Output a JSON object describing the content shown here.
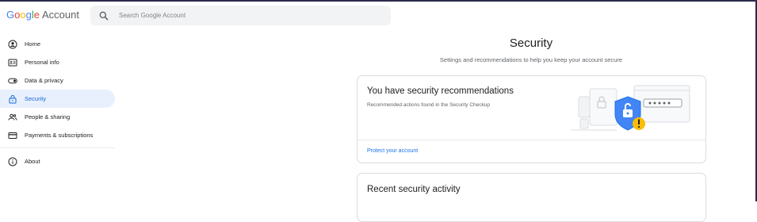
{
  "header": {
    "logo_google": [
      "G",
      "o",
      "o",
      "g",
      "l",
      "e"
    ],
    "logo_account": "Account",
    "search_placeholder": "Search Google Account"
  },
  "sidebar": {
    "items": [
      {
        "label": "Home",
        "icon": "home-icon"
      },
      {
        "label": "Personal info",
        "icon": "personal-info-icon"
      },
      {
        "label": "Data & privacy",
        "icon": "toggle-icon"
      },
      {
        "label": "Security",
        "icon": "lock-icon",
        "active": true
      },
      {
        "label": "People & sharing",
        "icon": "people-icon"
      },
      {
        "label": "Payments & subscriptions",
        "icon": "credit-card-icon"
      }
    ],
    "about": {
      "label": "About",
      "icon": "info-icon"
    }
  },
  "main": {
    "title": "Security",
    "subtitle": "Settings and recommendations to help you keep your account secure",
    "recommendations_card": {
      "title": "You have security recommendations",
      "description": "Recommended actions found in the Security Checkup",
      "link": "Protect your account"
    },
    "activity_card": {
      "title": "Recent security activity"
    }
  },
  "colors": {
    "accent": "#1a73e8",
    "active_bg": "#e8f0fe",
    "shield": "#4285f4",
    "warning": "#fbbc05"
  }
}
